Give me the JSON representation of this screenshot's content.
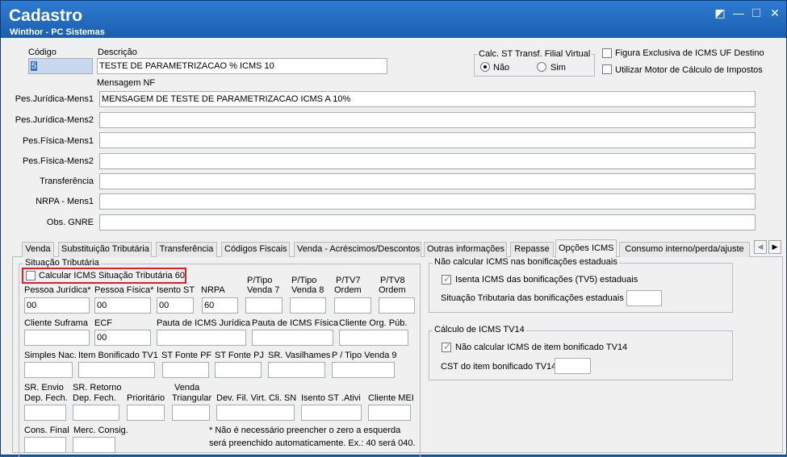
{
  "window": {
    "title": "Cadastro",
    "subtitle": "Winthor - PC Sistemas",
    "buttons": {
      "edit": "◩",
      "minimize": "—",
      "maximize": "☐",
      "close": "✕"
    }
  },
  "header": {
    "codigo_label": "Código",
    "codigo_value": "5",
    "descricao_label": "Descrição",
    "descricao_value": "TESTE DE PARAMETRIZACAO % ICMS 10",
    "calc_st_label": "Calc. ST Transf. Filial Virtual",
    "radio_nao": "Não",
    "radio_sim": "Sim",
    "chk_figura": "Figura Exclusiva de ICMS UF Destino",
    "chk_motor": "Utilizar Motor de Cálculo de Impostos"
  },
  "mensagem": {
    "section_label": "Mensagem NF",
    "rows": [
      {
        "label": "Pes.Jurídica-Mens1",
        "value": "MENSAGEM DE TESTE DE PARAMETRIZACAO ICMS A 10%"
      },
      {
        "label": "Pes.Jurídica-Mens2",
        "value": ""
      },
      {
        "label": "Pes.Física-Mens1",
        "value": ""
      },
      {
        "label": "Pes.Física-Mens2",
        "value": ""
      },
      {
        "label": "Transferência",
        "value": ""
      },
      {
        "label": "NRPA - Mens1",
        "value": ""
      },
      {
        "label": "Obs. GNRE",
        "value": ""
      }
    ]
  },
  "tabs": [
    "Venda",
    "Substituição Tributária",
    "Transferência",
    "Códigos Fiscais",
    "Venda - Acréscimos/Descontos",
    "Outras informações",
    "Repasse",
    "Opções ICMS",
    "Consumo interno/perda/ajuste"
  ],
  "tab_arrows": {
    "left": "◀",
    "right": "▶"
  },
  "situacao": {
    "group_title": "Situação Tributária",
    "chk_calcular": "Calcular ICMS Situação Tributária 60",
    "row1": {
      "pessoa_juridica": {
        "label": "Pessoa Jurídica*",
        "value": "00"
      },
      "pessoa_fisica": {
        "label": "Pessoa Física*",
        "value": "00"
      },
      "isento_st": {
        "label": "Isento ST",
        "value": "00"
      },
      "nrpa": {
        "label": "NRPA",
        "value": "60"
      },
      "p_tipo_venda7": {
        "label1": "P/Tipo",
        "label2": "Venda 7",
        "value": ""
      },
      "p_tipo_venda8": {
        "label1": "P/Tipo",
        "label2": "Venda 8",
        "value": ""
      },
      "p_tv7_ordem": {
        "label1": "P/TV7",
        "label2": "Ordem",
        "value": ""
      },
      "p_tv8_ordem": {
        "label1": "P/TV8",
        "label2": "Ordem",
        "value": ""
      }
    },
    "row2": {
      "cliente_suframa": {
        "label": "Cliente Suframa",
        "value": ""
      },
      "ecf": {
        "label": "ECF",
        "value": "00"
      },
      "pauta_juridica": {
        "label": "Pauta de ICMS Jurídica",
        "value": ""
      },
      "pauta_fisica": {
        "label": "Pauta de ICMS Física",
        "value": ""
      },
      "cliente_org_pub": {
        "label": "Cliente Org. Púb.",
        "value": ""
      }
    },
    "row3": {
      "simples_nac": {
        "label": "Simples Nac.",
        "value": ""
      },
      "item_bonificado": {
        "label": "Item Bonificado TV1",
        "value": ""
      },
      "st_fonte_pf": {
        "label": "ST Fonte PF",
        "value": ""
      },
      "st_fonte_pj": {
        "label": "ST Fonte PJ",
        "value": ""
      },
      "sr_vasilhames": {
        "label": "SR. Vasilhames",
        "value": ""
      },
      "p_tipo_venda9": {
        "label": "P / Tipo Venda 9",
        "value": ""
      }
    },
    "row4": {
      "sr_envio": {
        "label1": "SR. Envio",
        "label2": "Dep. Fech.",
        "value": ""
      },
      "sr_retorno": {
        "label1": "SR. Retorno",
        "label2": "Dep. Fech.",
        "value": ""
      },
      "prioritario": {
        "label": "Prioritário",
        "value": ""
      },
      "venda_triangular": {
        "label1": "Venda",
        "label2": "Triangular",
        "value": ""
      },
      "dev_fil_virt": {
        "label": "Dev. Fil. Virt. Cli. SN",
        "value": ""
      },
      "isento_st_ativi": {
        "label": "Isento ST .Ativi",
        "value": ""
      },
      "cliente_mei": {
        "label": "Cliente MEI",
        "value": ""
      }
    },
    "row5": {
      "cons_final": {
        "label": "Cons. Final",
        "value": ""
      },
      "merc_consig": {
        "label": "Merc. Consig.",
        "value": ""
      }
    },
    "note1": "* Não é necessário preencher o zero a esquerda",
    "note2": "será preenchido automaticamente.  Ex.: 40 será 040."
  },
  "bonificacoes": {
    "group_title": "Não calcular ICMS nas bonificações estaduais",
    "chk_isenta": "Isenta ICMS das bonificações (TV5) estaduais",
    "situacao_label": "Situação Tributaria das  bonificações estaduais",
    "situacao_value": ""
  },
  "tv14": {
    "group_title": "Cálculo de ICMS TV14",
    "chk_nao_calcular": "Não calcular ICMS de item bonificado TV14",
    "cst_label": "CST do item bonificado TV14",
    "cst_value": ""
  }
}
